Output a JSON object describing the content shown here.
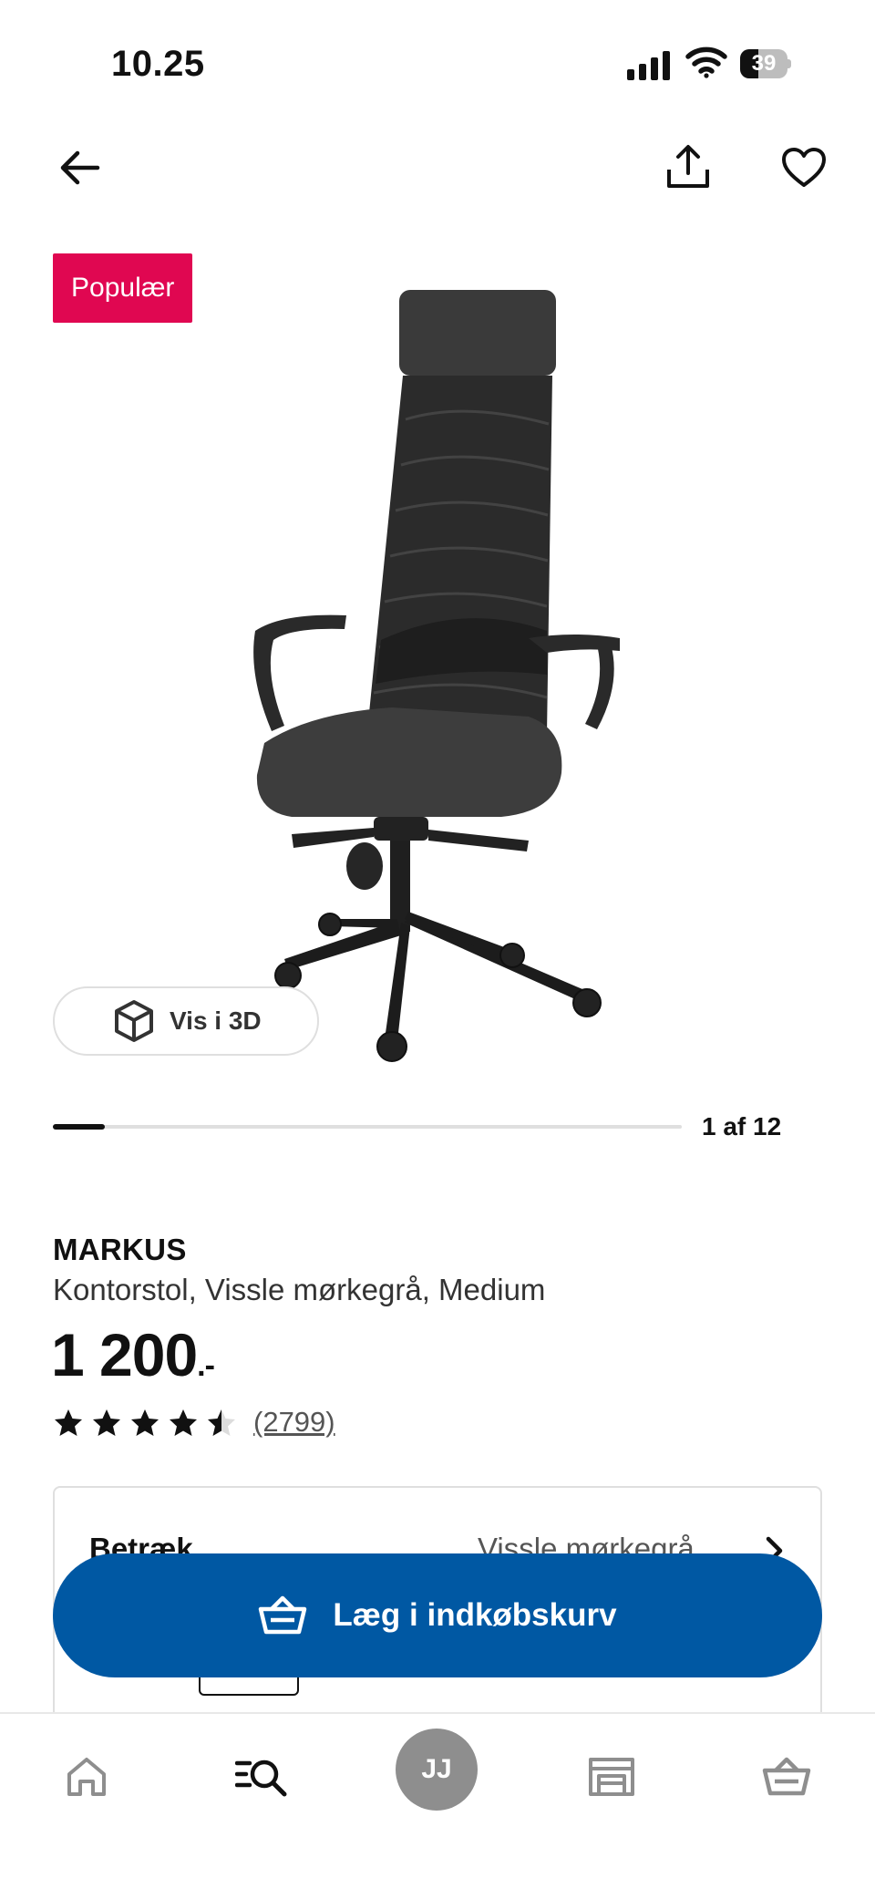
{
  "status_bar": {
    "time": "10.25",
    "battery": "39",
    "battery_level": 0.39
  },
  "top_nav": {
    "back_icon": "arrow-left-icon",
    "share_icon": "share-icon",
    "favorite_icon": "heart-icon"
  },
  "product": {
    "badge": "Populær",
    "image": "office-chair-image",
    "view_3d_label": "Vis i 3D",
    "carousel_counter": "1 af 12",
    "carousel_progress": 0.0833,
    "name": "MARKUS",
    "description": "Kontorstol, Vissle mørkegrå, Medium",
    "price": "1 200",
    "price_suffix": ".-",
    "rating": 4.5,
    "review_count": "(2799)"
  },
  "options": {
    "cover_label": "Betræk",
    "cover_value": "Vissle mørkegrå"
  },
  "cta": {
    "add_to_cart_label": "Læg i indkøbskurv",
    "icon": "basket-icon"
  },
  "tab_bar": {
    "home_icon": "home-icon",
    "search_icon": "search-list-icon",
    "avatar_initials": "JJ",
    "store_icon": "store-icon",
    "cart_icon": "basket-icon"
  },
  "colors": {
    "badge": "#e00751",
    "cta": "#0058a3",
    "avatar": "#8e8e8e"
  }
}
